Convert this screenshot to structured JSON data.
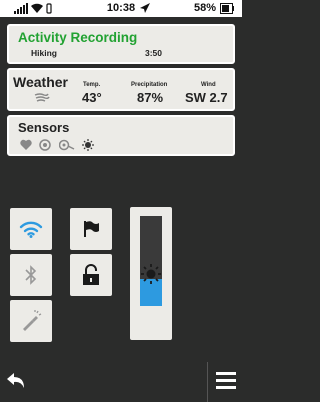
{
  "status_bar": {
    "time": "10:38",
    "battery_percent": "58%",
    "icons": [
      "signal-icon",
      "wifi-icon",
      "notification-icon",
      "gps-icon",
      "battery-icon"
    ]
  },
  "activity": {
    "title": "Activity Recording",
    "type": "Hiking",
    "duration": "3:50"
  },
  "weather": {
    "title": "Weather",
    "condition_icon": "wind-cloud-icon",
    "temp_label": "Temp.",
    "temp_value": "43°",
    "precip_label": "Precipitation",
    "precip_value": "87%",
    "wind_label": "Wind",
    "wind_value": "SW 2.7"
  },
  "sensors": {
    "title": "Sensors",
    "icons": [
      "heart-rate-icon",
      "speed-sensor-icon",
      "cadence-sensor-icon",
      "temperature-sensor-icon"
    ]
  },
  "controls": {
    "wifi_active": true,
    "bluetooth_active": false,
    "brightness_level": 0.3,
    "accent_color": "#2d9ae0"
  },
  "colors": {
    "activity_title": "#22a232",
    "background": "#2b2c2b",
    "card": "#ecebe7"
  }
}
